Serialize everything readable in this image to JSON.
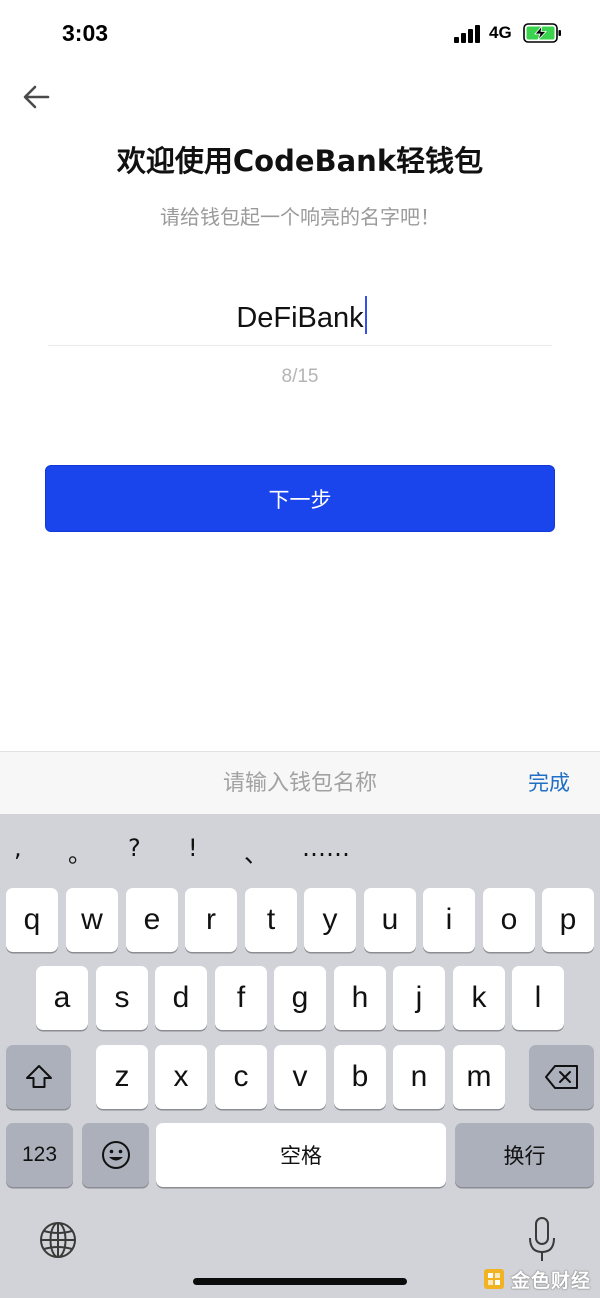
{
  "status_bar": {
    "time": "3:03",
    "network": "4G"
  },
  "header": {
    "title": "欢迎使用CodeBank轻钱包",
    "subtitle": "请给钱包起一个响亮的名字吧！"
  },
  "form": {
    "wallet_name_value": "DeFiBank",
    "counter": "8/15",
    "next_label": "下一步"
  },
  "accessory_bar": {
    "placeholder": "请输入钱包名称",
    "done_label": "完成"
  },
  "keyboard": {
    "punctuation": [
      ",",
      "。",
      "?",
      "!",
      "、",
      "……"
    ],
    "row1": [
      "q",
      "w",
      "e",
      "r",
      "t",
      "y",
      "u",
      "i",
      "o",
      "p"
    ],
    "row2": [
      "a",
      "s",
      "d",
      "f",
      "g",
      "h",
      "j",
      "k",
      "l"
    ],
    "row3": [
      "z",
      "x",
      "c",
      "v",
      "b",
      "n",
      "m"
    ],
    "numbers_label": "123",
    "space_label": "空格",
    "return_label": "换行"
  },
  "watermark": {
    "text": "金色财经"
  },
  "colors": {
    "primary_button": "#1a44ec",
    "done_link": "#1f6fc4",
    "keyboard_bg": "#d2d3d8",
    "battery_fill": "#3bd34e"
  }
}
